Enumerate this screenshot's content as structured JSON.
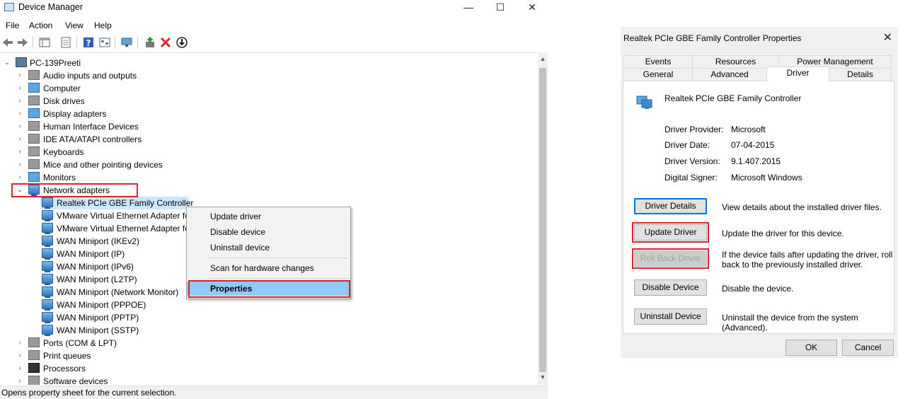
{
  "device_manager": {
    "title": "Device Manager",
    "window_controls": {
      "minimize": "—",
      "maximize": "☐",
      "close": "✕"
    },
    "menu": [
      "File",
      "Action",
      "View",
      "Help"
    ],
    "toolbar_icons": [
      "back-arrow-icon",
      "forward-arrow-icon",
      "properties-grid-icon",
      "list-view-icon",
      "help-icon",
      "show-hidden-icon",
      "monitor-scan-icon",
      "add-driver-icon",
      "uninstall-x-icon",
      "download-icon"
    ],
    "root": "PC-139Preeti",
    "categories": [
      {
        "label": "Audio inputs and outputs",
        "icon": "speaker-icon"
      },
      {
        "label": "Computer",
        "icon": "computer-icon"
      },
      {
        "label": "Disk drives",
        "icon": "disk-drive-icon"
      },
      {
        "label": "Display adapters",
        "icon": "display-adapter-icon"
      },
      {
        "label": "Human Interface Devices",
        "icon": "hid-icon"
      },
      {
        "label": "IDE ATA/ATAPI controllers",
        "icon": "ide-controller-icon"
      },
      {
        "label": "Keyboards",
        "icon": "keyboard-icon"
      },
      {
        "label": "Mice and other pointing devices",
        "icon": "mouse-icon"
      },
      {
        "label": "Monitors",
        "icon": "monitor-icon"
      },
      {
        "label": "Network adapters",
        "icon": "network-adapter-icon",
        "expanded": true
      }
    ],
    "network_children": [
      "Realtek PCIe GBE Family Controller",
      "VMware Virtual Ethernet Adapter fo",
      "VMware Virtual Ethernet Adapter fo",
      "WAN Miniport (IKEv2)",
      "WAN Miniport (IP)",
      "WAN Miniport (IPv6)",
      "WAN Miniport (L2TP)",
      "WAN Miniport (Network Monitor)",
      "WAN Miniport (PPPOE)",
      "WAN Miniport (PPTP)",
      "WAN Miniport (SSTP)"
    ],
    "after_categories": [
      {
        "label": "Ports (COM & LPT)",
        "icon": "port-icon"
      },
      {
        "label": "Print queues",
        "icon": "printer-icon"
      },
      {
        "label": "Processors",
        "icon": "processor-icon"
      },
      {
        "label": "Software devices",
        "icon": "software-device-icon"
      }
    ],
    "status": "Opens property sheet for the current selection."
  },
  "context_menu": {
    "items": [
      "Update driver",
      "Disable device",
      "Uninstall device"
    ],
    "scan": "Scan for hardware changes",
    "properties": "Properties"
  },
  "properties_dialog": {
    "title": "Realtek PCIe GBE Family Controller Properties",
    "close": "✕",
    "tabs_top": [
      "Events",
      "Resources",
      "Power Management"
    ],
    "tabs_bottom": [
      "General",
      "Advanced",
      "Driver",
      "Details"
    ],
    "active_tab": "Driver",
    "device_name": "Realtek PCIe GBE Family Controller",
    "fields": [
      {
        "key": "Driver Provider:",
        "value": "Microsoft"
      },
      {
        "key": "Driver Date:",
        "value": "07-04-2015"
      },
      {
        "key": "Driver Version:",
        "value": "9.1.407.2015"
      },
      {
        "key": "Digital Signer:",
        "value": "Microsoft Windows"
      }
    ],
    "actions": [
      {
        "button": "Driver Details",
        "desc": "View details about the installed driver files."
      },
      {
        "button": "Update Driver",
        "desc": "Update the driver for this device."
      },
      {
        "button": "Roll Back Driver",
        "desc": "If the device fails after updating the driver, roll back to the previously installed driver."
      },
      {
        "button": "Disable Device",
        "desc": "Disable the device."
      },
      {
        "button": "Uninstall Device",
        "desc": "Uninstall the device from the system (Advanced)."
      }
    ],
    "ok": "OK",
    "cancel": "Cancel"
  },
  "colors": {
    "highlight_red": "#d9232e",
    "selection_blue": "#cce8ff",
    "menu_hover": "#91c9f7"
  }
}
